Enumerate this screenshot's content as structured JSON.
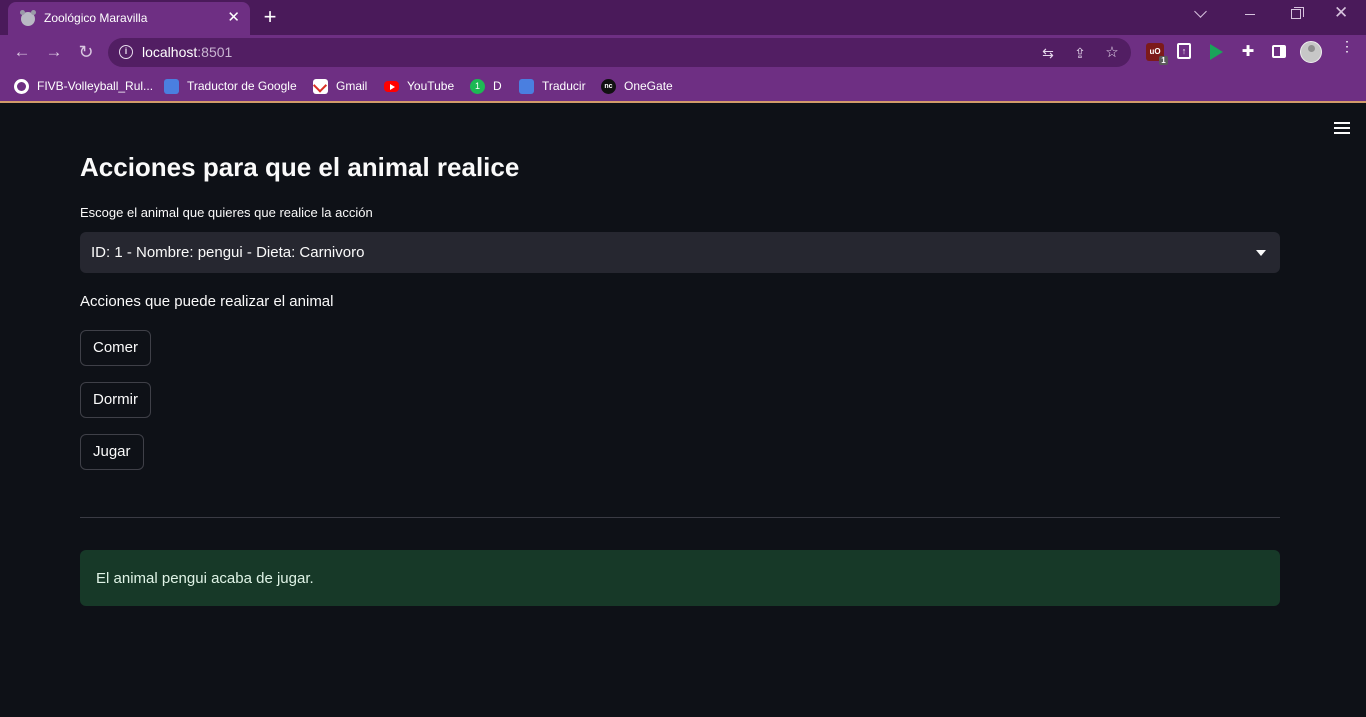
{
  "browser": {
    "tab": {
      "title": "Zoológico Maravilla",
      "close": "✕"
    },
    "new_tab": "+",
    "window_controls": {
      "close": "✕"
    },
    "address": {
      "host": "localhost",
      "port": ":8501"
    },
    "bookmarks": [
      {
        "label": "FIVB-Volleyball_Rul..."
      },
      {
        "label": "Traductor de Google"
      },
      {
        "label": "Gmail"
      },
      {
        "label": "YouTube"
      },
      {
        "label": "D",
        "icon_text": "1"
      },
      {
        "label": "Traducir"
      },
      {
        "label": "OneGate",
        "icon_text": "nc"
      }
    ],
    "extensions": {
      "ublock_badge": "1"
    }
  },
  "page": {
    "title": "Acciones para que el animal realice",
    "select": {
      "label": "Escoge el animal que quieres que realice la acción",
      "value": "ID: 1 - Nombre: pengui - Dieta: Carnivoro"
    },
    "actions_label": "Acciones que puede realizar el animal",
    "buttons": {
      "comer": "Comer",
      "dormir": "Dormir",
      "jugar": "Jugar"
    },
    "alert": {
      "text": "El animal pengui acaba de jugar."
    }
  },
  "colors": {
    "titlebar": "#4a1a5a",
    "toolbar": "#6e2f83",
    "app_background": "#0e1117",
    "select_background": "#262730",
    "success_background": "#173928"
  }
}
